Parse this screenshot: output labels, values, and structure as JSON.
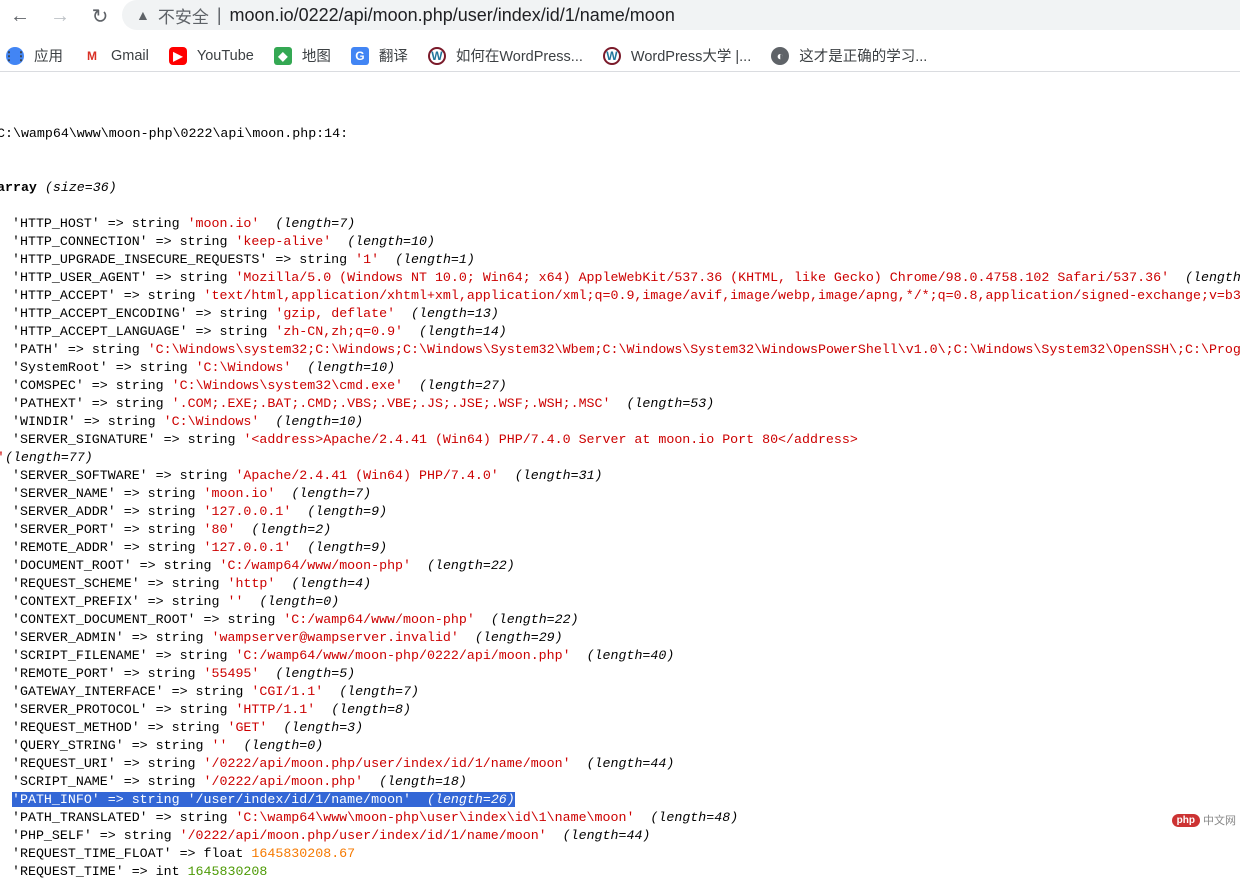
{
  "browser": {
    "url": "moon.io/0222/api/moon.php/user/index/id/1/name/moon",
    "security_label": "不安全"
  },
  "bookmarks": [
    {
      "label": "应用",
      "icon": "apps-grid-icon"
    },
    {
      "label": "Gmail",
      "icon": "gmail-icon"
    },
    {
      "label": "YouTube",
      "icon": "youtube-icon"
    },
    {
      "label": "地图",
      "icon": "maps-icon"
    },
    {
      "label": "翻译",
      "icon": "translate-icon"
    },
    {
      "label": "如何在WordPress...",
      "icon": "wordpress-icon"
    },
    {
      "label": "WordPress大学 |...",
      "icon": "wordpress-icon"
    },
    {
      "label": "这才是正确的学习...",
      "icon": "globe-icon"
    }
  ],
  "dump": {
    "file": "C:\\wamp64\\www\\moon-php\\0222\\api\\moon.php:14:",
    "type": "array",
    "size": "(size=36)",
    "entries": [
      {
        "key": "'HTTP_HOST'",
        "type": "string",
        "value": "'moon.io'",
        "length": "(length=7)"
      },
      {
        "key": "'HTTP_CONNECTION'",
        "type": "string",
        "value": "'keep-alive'",
        "length": "(length=10)"
      },
      {
        "key": "'HTTP_UPGRADE_INSECURE_REQUESTS'",
        "type": "string",
        "value": "'1'",
        "length": "(length=1)"
      },
      {
        "key": "'HTTP_USER_AGENT'",
        "type": "string",
        "value": "'Mozilla/5.0 (Windows NT 10.0; Win64; x64) AppleWebKit/537.36 (KHTML, like Gecko) Chrome/98.0.4758.102 Safari/537.36'",
        "length": "(length"
      },
      {
        "key": "'HTTP_ACCEPT'",
        "type": "string",
        "value": "'text/html,application/xhtml+xml,application/xml;q=0.9,image/avif,image/webp,image/apng,*/*;q=0.8,application/signed-exchange;v=b3",
        "length": ""
      },
      {
        "key": "'HTTP_ACCEPT_ENCODING'",
        "type": "string",
        "value": "'gzip, deflate'",
        "length": "(length=13)"
      },
      {
        "key": "'HTTP_ACCEPT_LANGUAGE'",
        "type": "string",
        "value": "'zh-CN,zh;q=0.9'",
        "length": "(length=14)"
      },
      {
        "key": "'PATH'",
        "type": "string",
        "value": "'C:\\Windows\\system32;C:\\Windows;C:\\Windows\\System32\\Wbem;C:\\Windows\\System32\\WindowsPowerShell\\v1.0\\;C:\\Windows\\System32\\OpenSSH\\;C:\\Prog",
        "length": ""
      },
      {
        "key": "'SystemRoot'",
        "type": "string",
        "value": "'C:\\Windows'",
        "length": "(length=10)"
      },
      {
        "key": "'COMSPEC'",
        "type": "string",
        "value": "'C:\\Windows\\system32\\cmd.exe'",
        "length": "(length=27)"
      },
      {
        "key": "'PATHEXT'",
        "type": "string",
        "value": "'.COM;.EXE;.BAT;.CMD;.VBS;.VBE;.JS;.JSE;.WSF;.WSH;.MSC'",
        "length": "(length=53)"
      },
      {
        "key": "'WINDIR'",
        "type": "string",
        "value": "'C:\\Windows'",
        "length": "(length=10)"
      },
      {
        "key": "'SERVER_SIGNATURE'",
        "type": "string",
        "value": "'<address>Apache/2.4.41 (Win64) PHP/7.4.0 Server at moon.io Port 80</address>\n'",
        "length": "(length=77)",
        "wrap": true
      },
      {
        "key": "'SERVER_SOFTWARE'",
        "type": "string",
        "value": "'Apache/2.4.41 (Win64) PHP/7.4.0'",
        "length": "(length=31)"
      },
      {
        "key": "'SERVER_NAME'",
        "type": "string",
        "value": "'moon.io'",
        "length": "(length=7)"
      },
      {
        "key": "'SERVER_ADDR'",
        "type": "string",
        "value": "'127.0.0.1'",
        "length": "(length=9)"
      },
      {
        "key": "'SERVER_PORT'",
        "type": "string",
        "value": "'80'",
        "length": "(length=2)"
      },
      {
        "key": "'REMOTE_ADDR'",
        "type": "string",
        "value": "'127.0.0.1'",
        "length": "(length=9)"
      },
      {
        "key": "'DOCUMENT_ROOT'",
        "type": "string",
        "value": "'C:/wamp64/www/moon-php'",
        "length": "(length=22)"
      },
      {
        "key": "'REQUEST_SCHEME'",
        "type": "string",
        "value": "'http'",
        "length": "(length=4)"
      },
      {
        "key": "'CONTEXT_PREFIX'",
        "type": "string",
        "value": "''",
        "length": "(length=0)"
      },
      {
        "key": "'CONTEXT_DOCUMENT_ROOT'",
        "type": "string",
        "value": "'C:/wamp64/www/moon-php'",
        "length": "(length=22)"
      },
      {
        "key": "'SERVER_ADMIN'",
        "type": "string",
        "value": "'wampserver@wampserver.invalid'",
        "length": "(length=29)"
      },
      {
        "key": "'SCRIPT_FILENAME'",
        "type": "string",
        "value": "'C:/wamp64/www/moon-php/0222/api/moon.php'",
        "length": "(length=40)"
      },
      {
        "key": "'REMOTE_PORT'",
        "type": "string",
        "value": "'55495'",
        "length": "(length=5)"
      },
      {
        "key": "'GATEWAY_INTERFACE'",
        "type": "string",
        "value": "'CGI/1.1'",
        "length": "(length=7)"
      },
      {
        "key": "'SERVER_PROTOCOL'",
        "type": "string",
        "value": "'HTTP/1.1'",
        "length": "(length=8)"
      },
      {
        "key": "'REQUEST_METHOD'",
        "type": "string",
        "value": "'GET'",
        "length": "(length=3)"
      },
      {
        "key": "'QUERY_STRING'",
        "type": "string",
        "value": "''",
        "length": "(length=0)"
      },
      {
        "key": "'REQUEST_URI'",
        "type": "string",
        "value": "'/0222/api/moon.php/user/index/id/1/name/moon'",
        "length": "(length=44)"
      },
      {
        "key": "'SCRIPT_NAME'",
        "type": "string",
        "value": "'/0222/api/moon.php'",
        "length": "(length=18)"
      },
      {
        "key": "'PATH_INFO'",
        "type": "string",
        "value": "'/user/index/id/1/name/moon'",
        "length": "(length=26)",
        "selected": true
      },
      {
        "key": "'PATH_TRANSLATED'",
        "type": "string",
        "value": "'C:\\wamp64\\www\\moon-php\\user\\index\\id\\1\\name\\moon'",
        "length": "(length=48)"
      },
      {
        "key": "'PHP_SELF'",
        "type": "string",
        "value": "'/0222/api/moon.php/user/index/id/1/name/moon'",
        "length": "(length=44)"
      },
      {
        "key": "'REQUEST_TIME_FLOAT'",
        "type": "float",
        "value": "1645830208.67",
        "length": ""
      },
      {
        "key": "'REQUEST_TIME'",
        "type": "int",
        "value": "1645830208",
        "length": ""
      }
    ]
  },
  "watermark": {
    "badge": "php",
    "text": "中文网"
  }
}
